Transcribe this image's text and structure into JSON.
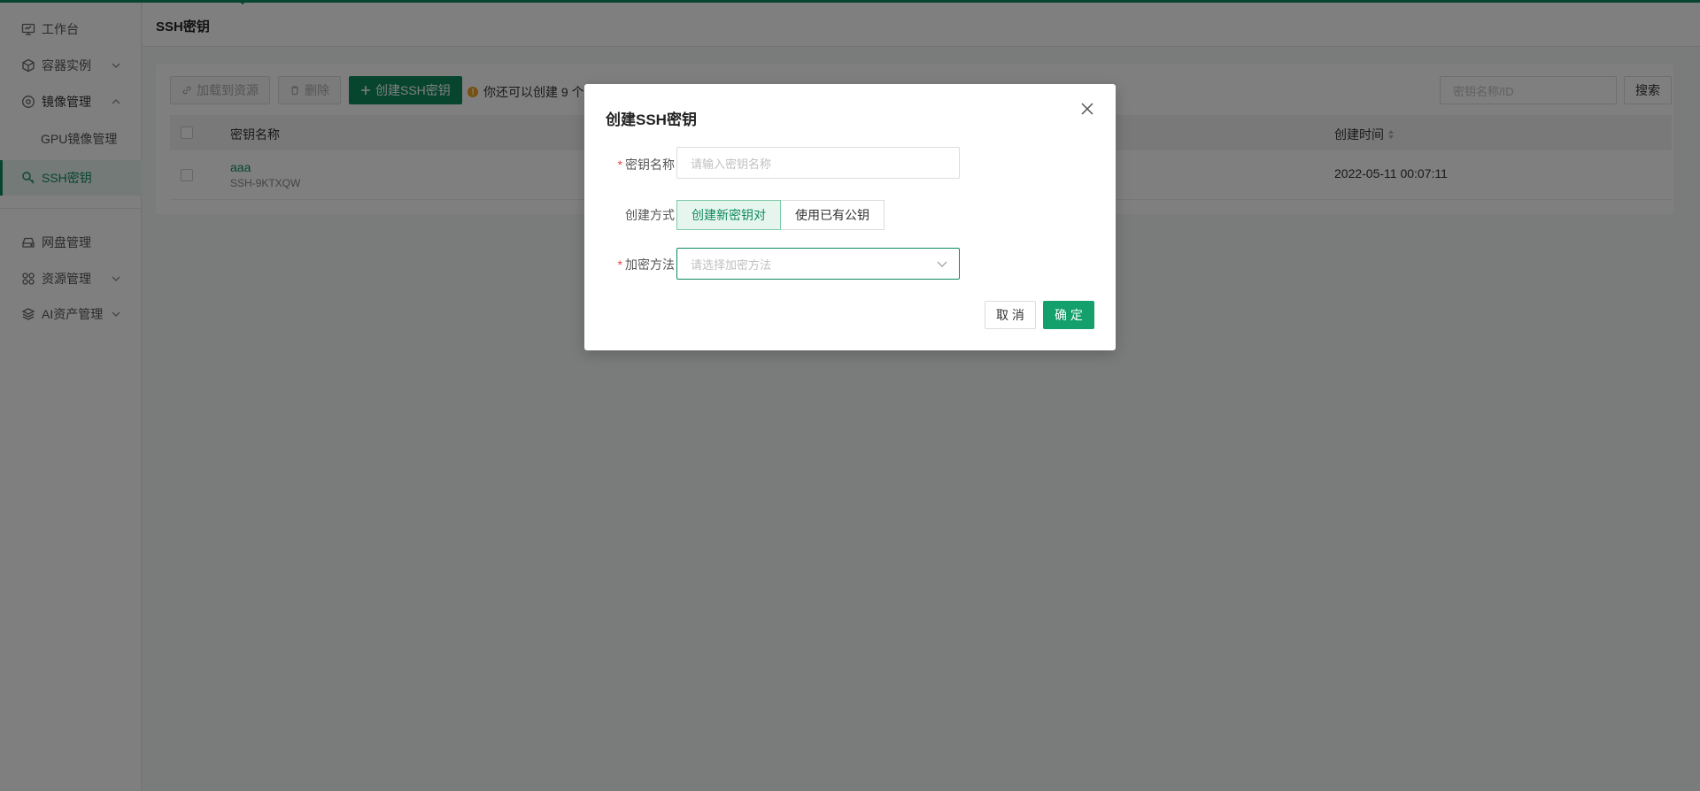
{
  "sidebar": {
    "items": [
      {
        "label": "工作台",
        "icon": "monitor-icon"
      },
      {
        "label": "容器实例",
        "icon": "cube-icon"
      },
      {
        "label": "镜像管理",
        "icon": "disc-icon"
      },
      {
        "label": "GPU镜像管理"
      },
      {
        "label": "SSH密钥",
        "icon": "key-icon"
      },
      {
        "label": "网盘管理",
        "icon": "drive-icon"
      },
      {
        "label": "资源管理",
        "icon": "grid-icon"
      },
      {
        "label": "AI资产管理",
        "icon": "layers-icon"
      }
    ]
  },
  "header": {
    "title": "SSH密钥"
  },
  "toolbar": {
    "attach_label": "加载到资源",
    "delete_label": "删除",
    "create_label": "创建SSH密钥",
    "tip": "你还可以创建 9 个",
    "search_placeholder": "密钥名称/ID",
    "search_label": "搜索"
  },
  "table": {
    "columns": [
      "密钥名称",
      "创建时间"
    ],
    "rows": [
      {
        "name": "aaa",
        "id": "SSH-9KTXQW",
        "created": "2022-05-11 00:07:11"
      }
    ]
  },
  "modal": {
    "title": "创建SSH密钥",
    "name_label": "密钥名称",
    "name_placeholder": "请输入密钥名称",
    "method_label": "创建方式",
    "method_options": [
      "创建新密钥对",
      "使用已有公钥"
    ],
    "encrypt_label": "加密方法",
    "encrypt_placeholder": "请选择加密方法",
    "cancel_label": "取 消",
    "ok_label": "确 定"
  },
  "colors": {
    "accent": "#0e8a5f",
    "ok_button": "#13a06c",
    "required": "#e64545"
  }
}
